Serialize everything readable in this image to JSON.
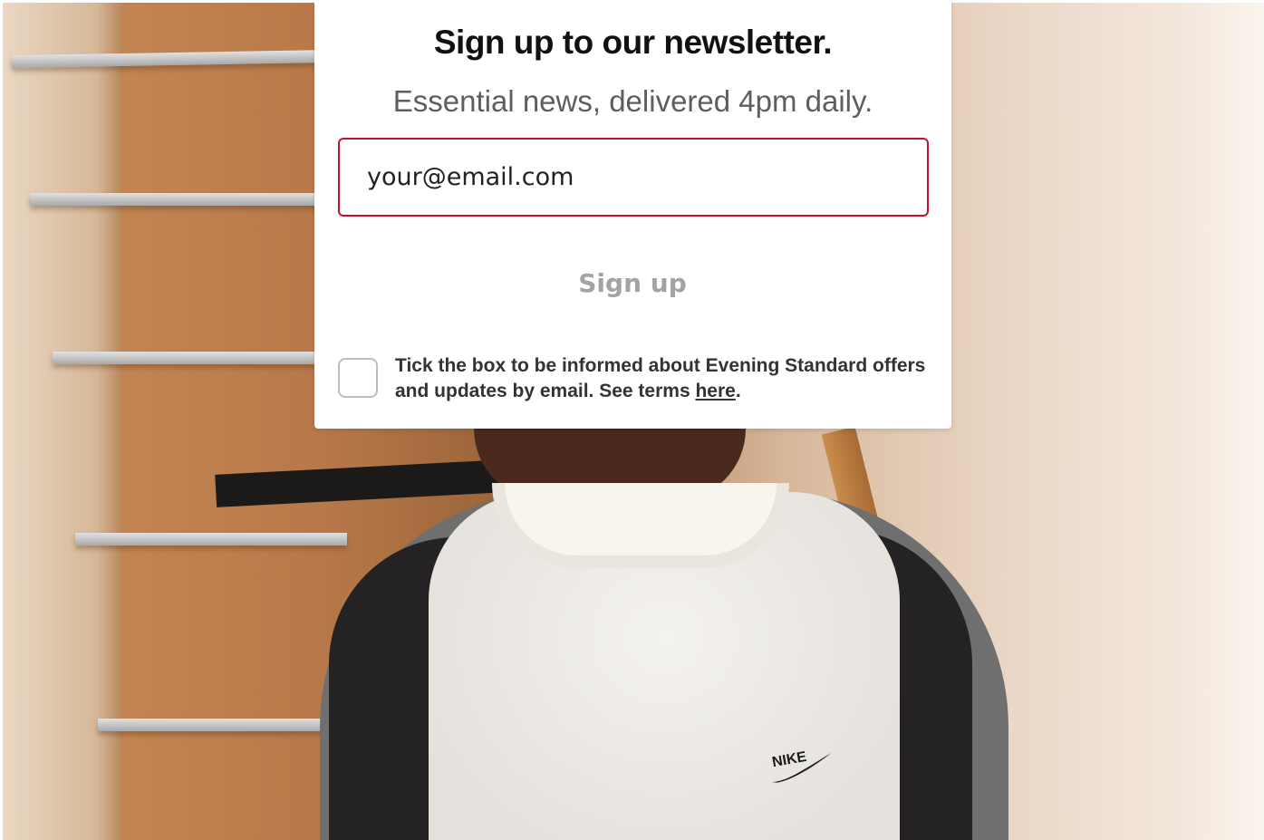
{
  "newsletter": {
    "title": "Sign up to our newsletter.",
    "subtitle": "Essential news, delivered 4pm daily.",
    "email_placeholder": "your@email.com",
    "signup_label": "Sign up",
    "consent_text": "Tick the box to be informed about Evening Standard offers and updates by email. See terms ",
    "consent_link_label": "here",
    "consent_suffix": ".",
    "consent_checked": false
  },
  "colors": {
    "accent": "#c8102e",
    "button_text": "#a3a3a3",
    "title_text": "#111111",
    "subtitle_text": "#5e5e5e"
  },
  "background": {
    "print_text": "NIKE"
  }
}
